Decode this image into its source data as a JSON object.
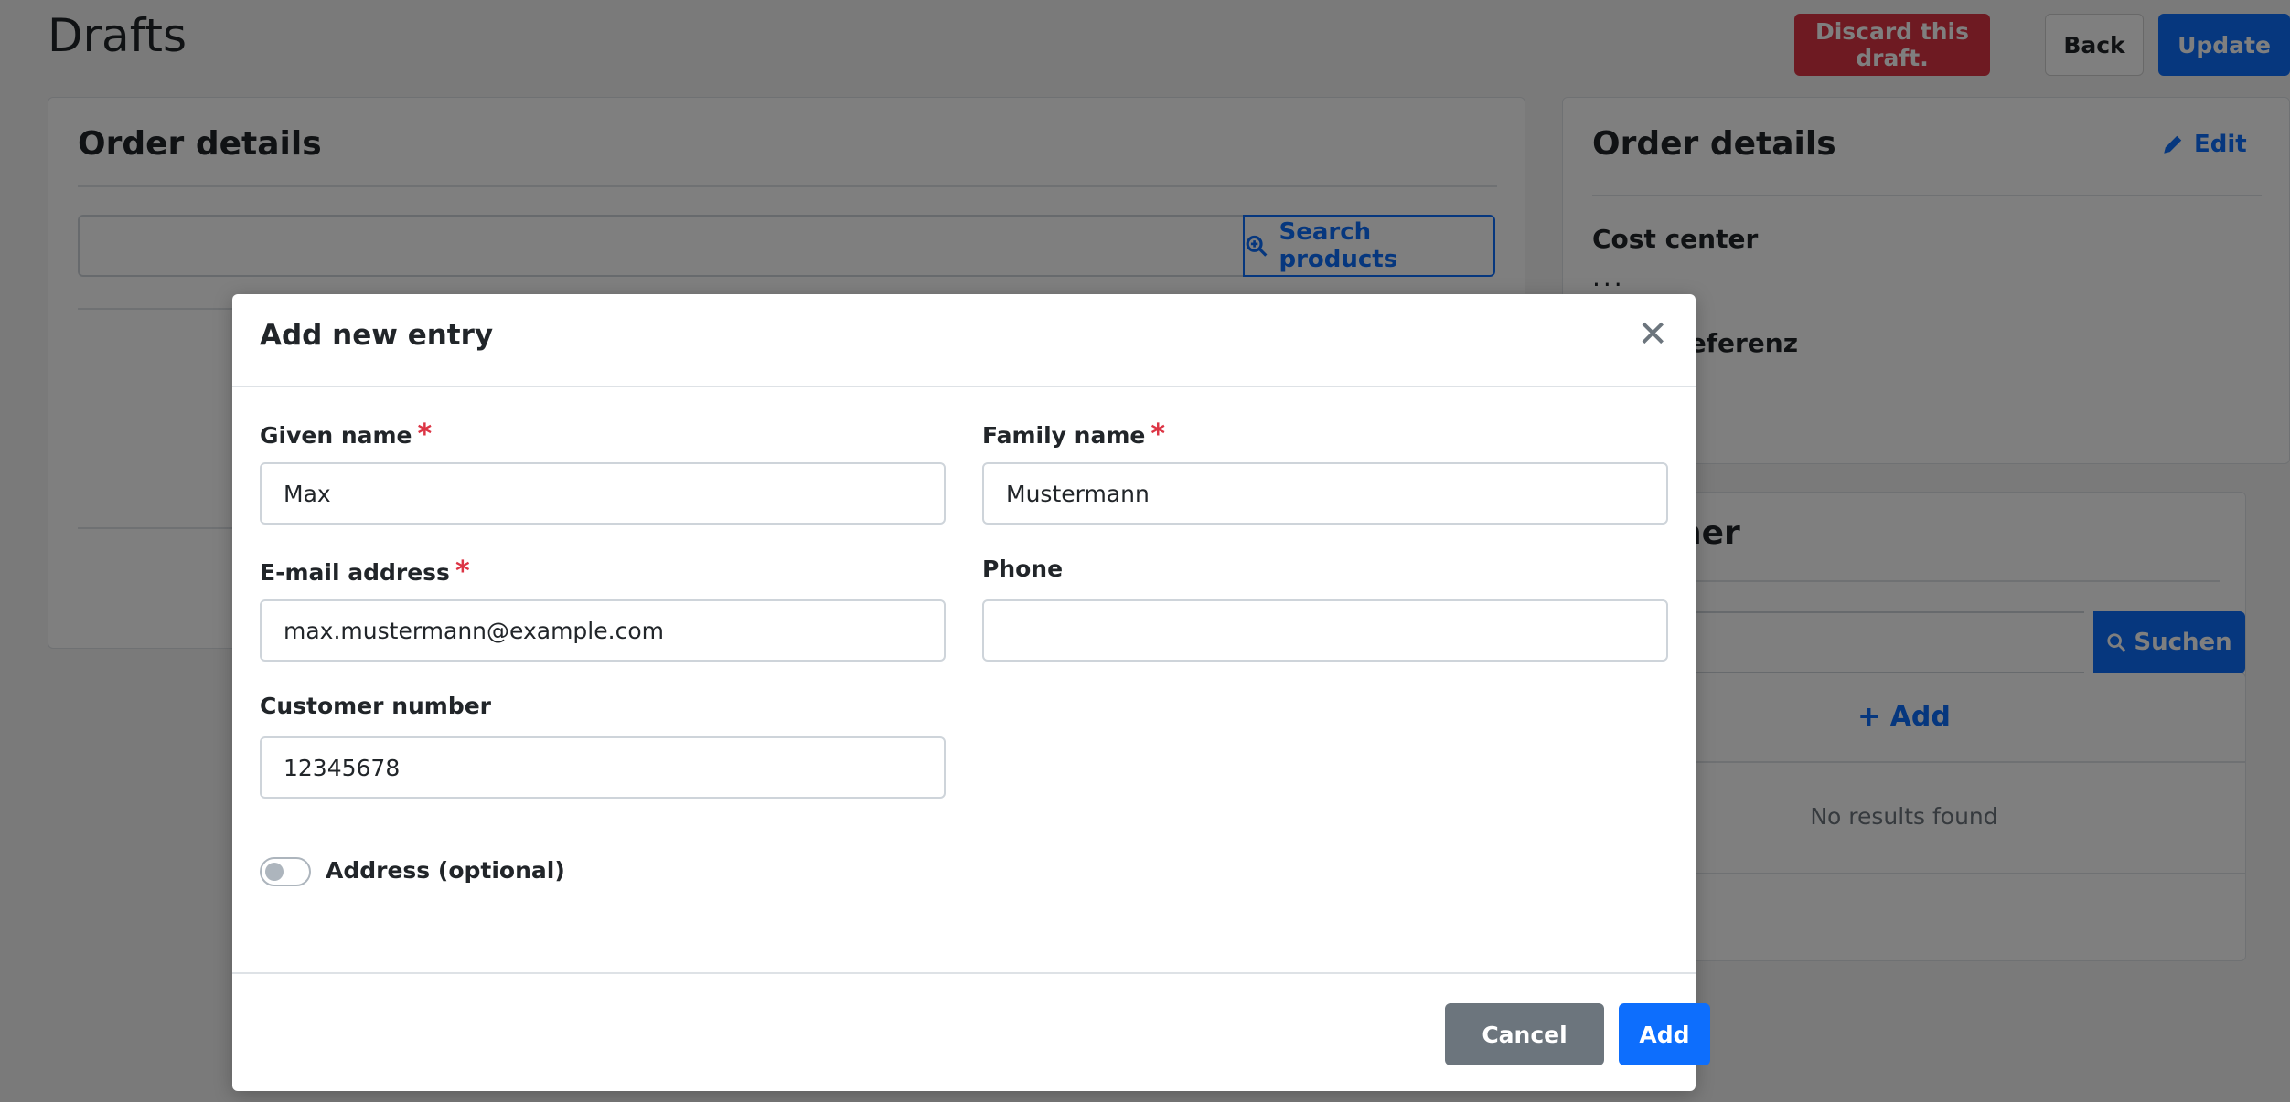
{
  "page": {
    "title": "Drafts",
    "buttons": {
      "discard": "Discard this draft.",
      "back": "Back",
      "update": "Update"
    }
  },
  "left_card": {
    "title": "Order details",
    "search_button": "Search products",
    "search_icon": "zoom-in-icon"
  },
  "right_card": {
    "title": "Order details",
    "edit_label": "Edit",
    "edit_icon": "pencil-icon",
    "cost_center_label": "Cost center",
    "cost_center_value": "...",
    "reference_label_partial": "referenz"
  },
  "customer_card": {
    "title_partial": "ner",
    "search_button": "Suchen",
    "add_label": "Add",
    "no_results": "No results found"
  },
  "modal": {
    "title": "Add new entry",
    "close_icon": "close-icon",
    "fields": {
      "given_name": {
        "label": "Given name",
        "value": "Max",
        "required": "*"
      },
      "family_name": {
        "label": "Family name",
        "value": "Mustermann",
        "required": "*"
      },
      "email": {
        "label": "E-mail address",
        "value": "max.mustermann@example.com",
        "required": "*"
      },
      "phone": {
        "label": "Phone",
        "value": ""
      },
      "customer_number": {
        "label": "Customer number",
        "value": "12345678"
      }
    },
    "address_toggle_label": "Address (optional)",
    "address_toggle_on": false,
    "buttons": {
      "cancel": "Cancel",
      "add": "Add"
    }
  },
  "colors": {
    "primary": "#0d6efd",
    "danger": "#dc3545",
    "secondary": "#6c757d"
  }
}
